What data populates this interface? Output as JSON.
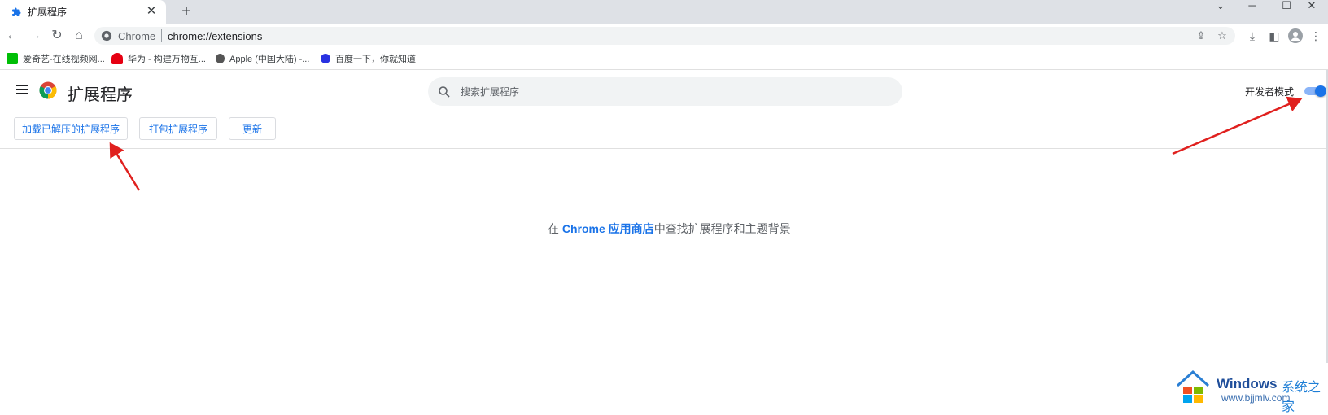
{
  "tab": {
    "title": "扩展程序",
    "close": "✕"
  },
  "window": {
    "minimize": "⌄",
    "min2": "─",
    "maximize": "☐",
    "close": "✕"
  },
  "omnibox": {
    "site": "Chrome",
    "url": "chrome://extensions"
  },
  "bookmarks": [
    {
      "label": "爱奇艺-在线视频网...",
      "color": "#00be06"
    },
    {
      "label": "华为 - 构建万物互...",
      "color": "#e60012"
    },
    {
      "label": "Apple (中国大陆) -...",
      "color": "#555555"
    },
    {
      "label": "百度一下，你就知道",
      "color": "#2932e1"
    }
  ],
  "header": {
    "title": "扩展程序",
    "search_placeholder": "搜索扩展程序",
    "dev_mode_label": "开发者模式",
    "dev_mode_on": true
  },
  "buttons": {
    "load_unpacked": "加载已解压的扩展程序",
    "pack": "打包扩展程序",
    "update": "更新"
  },
  "message": {
    "prefix": "在 ",
    "link": "Chrome 应用商店",
    "suffix": "中查找扩展程序和主题背景"
  },
  "watermark": {
    "brand": "Windows",
    "brand_cn": "系统之家",
    "url": "www.bjjmlv.com"
  },
  "colors": {
    "accent": "#1a73e8",
    "annotation": "#e0201e"
  }
}
